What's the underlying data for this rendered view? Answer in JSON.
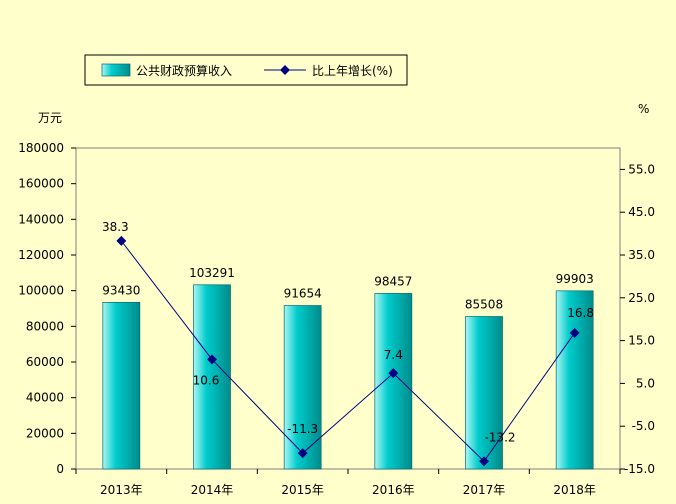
{
  "chart_data": {
    "type": "bar",
    "categories": [
      "2013年",
      "2014年",
      "2015年",
      "2016年",
      "2017年",
      "2018年"
    ],
    "series": [
      {
        "name": "公共财政预算收入",
        "kind": "bar",
        "axis": "left",
        "values": [
          93430,
          103291,
          91654,
          98457,
          85508,
          99903
        ],
        "labels": [
          "93430",
          "103291",
          "91654",
          "98457",
          "85508",
          "99903"
        ]
      },
      {
        "name": "比上年增长(%)",
        "kind": "line",
        "axis": "right",
        "values": [
          38.3,
          10.6,
          -11.3,
          7.4,
          -13.2,
          16.8
        ],
        "labels": [
          "38.3",
          "10.6",
          "-11.3",
          "7.4",
          "-13.2",
          "16.8"
        ]
      }
    ],
    "y_left": {
      "unit": "万元",
      "ylim": [
        0,
        180000
      ],
      "ticks": [
        0,
        20000,
        40000,
        60000,
        80000,
        100000,
        120000,
        140000,
        160000,
        180000
      ],
      "tick_labels": [
        "0",
        "20000",
        "40000",
        "60000",
        "80000",
        "100000",
        "120000",
        "140000",
        "160000",
        "180000"
      ]
    },
    "y_right": {
      "unit": "%",
      "ylim": [
        -15,
        60
      ],
      "ticks": [
        -15,
        -5,
        5,
        15,
        25,
        35,
        45,
        55
      ],
      "tick_labels": [
        "-15.0",
        "-5.0",
        "5.0",
        "15.0",
        "25.0",
        "35.0",
        "45.0",
        "55.0"
      ]
    },
    "legend": {
      "position": "top"
    },
    "grid": false,
    "colors": {
      "bar": "#00cccc",
      "bar_light": "#aaf5f5",
      "bar_dark": "#008b8b",
      "line": "#000080",
      "background": "#ffffcc"
    }
  }
}
